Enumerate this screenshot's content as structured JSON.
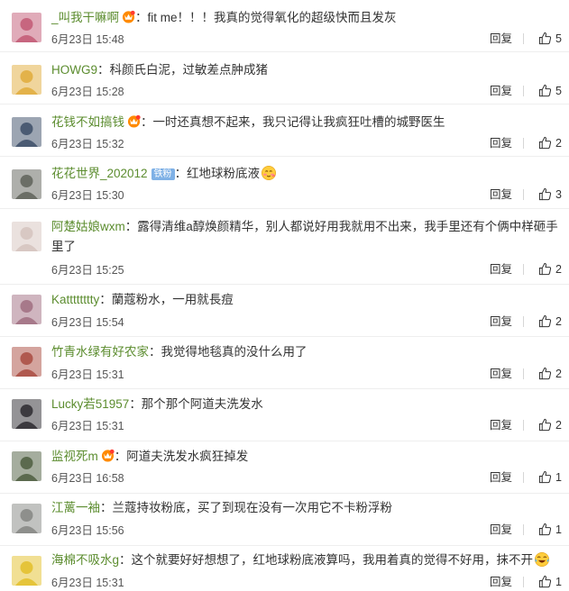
{
  "comments": [
    {
      "user": "_叫我干嘛啊",
      "vip": true,
      "fans_badge": "",
      "text": "：fit me！！！我真的觉得氧化的超级快而且发灰",
      "emoji": "",
      "time": "6月23日 15:48",
      "reply": "回复",
      "likes": "5",
      "avatar": "#c7667f"
    },
    {
      "user": "HOWG9",
      "vip": false,
      "fans_badge": "",
      "text": "：科颜氏白泥，过敏差点肿成猪",
      "emoji": "",
      "time": "6月23日 15:28",
      "reply": "回复",
      "likes": "5",
      "avatar": "#e3b24a"
    },
    {
      "user": "花钱不如搞钱",
      "vip": true,
      "fans_badge": "",
      "text": "：一时还真想不起来，我只记得让我疯狂吐槽的城野医生",
      "emoji": "",
      "time": "6月23日 15:32",
      "reply": "回复",
      "likes": "2",
      "avatar": "#4b5b73"
    },
    {
      "user": "花花世界_202012",
      "vip": false,
      "fans_badge": "铁粉",
      "text": "：红地球粉底液",
      "emoji": "blush-emoji",
      "time": "6月23日 15:30",
      "reply": "回复",
      "likes": "3",
      "avatar": "#6b6e66"
    },
    {
      "user": "阿楚姑娘wxm",
      "vip": false,
      "fans_badge": "",
      "text": "：露得清维a醇焕颜精华，别人都说好用我就用不出来，我手里还有个俩中样砸手里了",
      "emoji": "",
      "time": "6月23日 15:25",
      "reply": "回复",
      "likes": "2",
      "avatar": "#d8c8c3"
    },
    {
      "user": "Katttttttty",
      "vip": false,
      "fans_badge": "",
      "text": "：蘭蔻粉水，一用就長痘",
      "emoji": "",
      "time": "6月23日 15:54",
      "reply": "回复",
      "likes": "2",
      "avatar": "#a7798a"
    },
    {
      "user": "竹青水绿有好农家",
      "vip": false,
      "fans_badge": "",
      "text": "：我觉得地毯真的没什么用了",
      "emoji": "",
      "time": "6月23日 15:31",
      "reply": "回复",
      "likes": "2",
      "avatar": "#b0594f"
    },
    {
      "user": "Lucky若51957",
      "vip": false,
      "fans_badge": "",
      "text": "：那个那个阿道夫洗发水",
      "emoji": "",
      "time": "6月23日 15:31",
      "reply": "回复",
      "likes": "2",
      "avatar": "#3c3a3f"
    },
    {
      "user": "监视死m",
      "vip": true,
      "fans_badge": "",
      "text": "：阿道夫洗发水疯狂掉发",
      "emoji": "",
      "time": "6月23日 16:58",
      "reply": "回复",
      "likes": "1",
      "avatar": "#5b6a4e"
    },
    {
      "user": "江蓠一袖",
      "vip": false,
      "fans_badge": "",
      "text": "：兰蔻持妆粉底，买了到现在没有一次用它不卡粉浮粉",
      "emoji": "",
      "time": "6月23日 15:56",
      "reply": "回复",
      "likes": "1",
      "avatar": "#8e8f8c"
    },
    {
      "user": "海棉不吸水g",
      "vip": false,
      "fans_badge": "",
      "text": "：这个就要好好想想了，红地球粉底液算吗，我用着真的觉得不好用，抹不开",
      "emoji": "laugh-cry-emoji",
      "time": "6月23日 15:31",
      "reply": "回复",
      "likes": "1",
      "avatar": "#e5c43a"
    }
  ]
}
